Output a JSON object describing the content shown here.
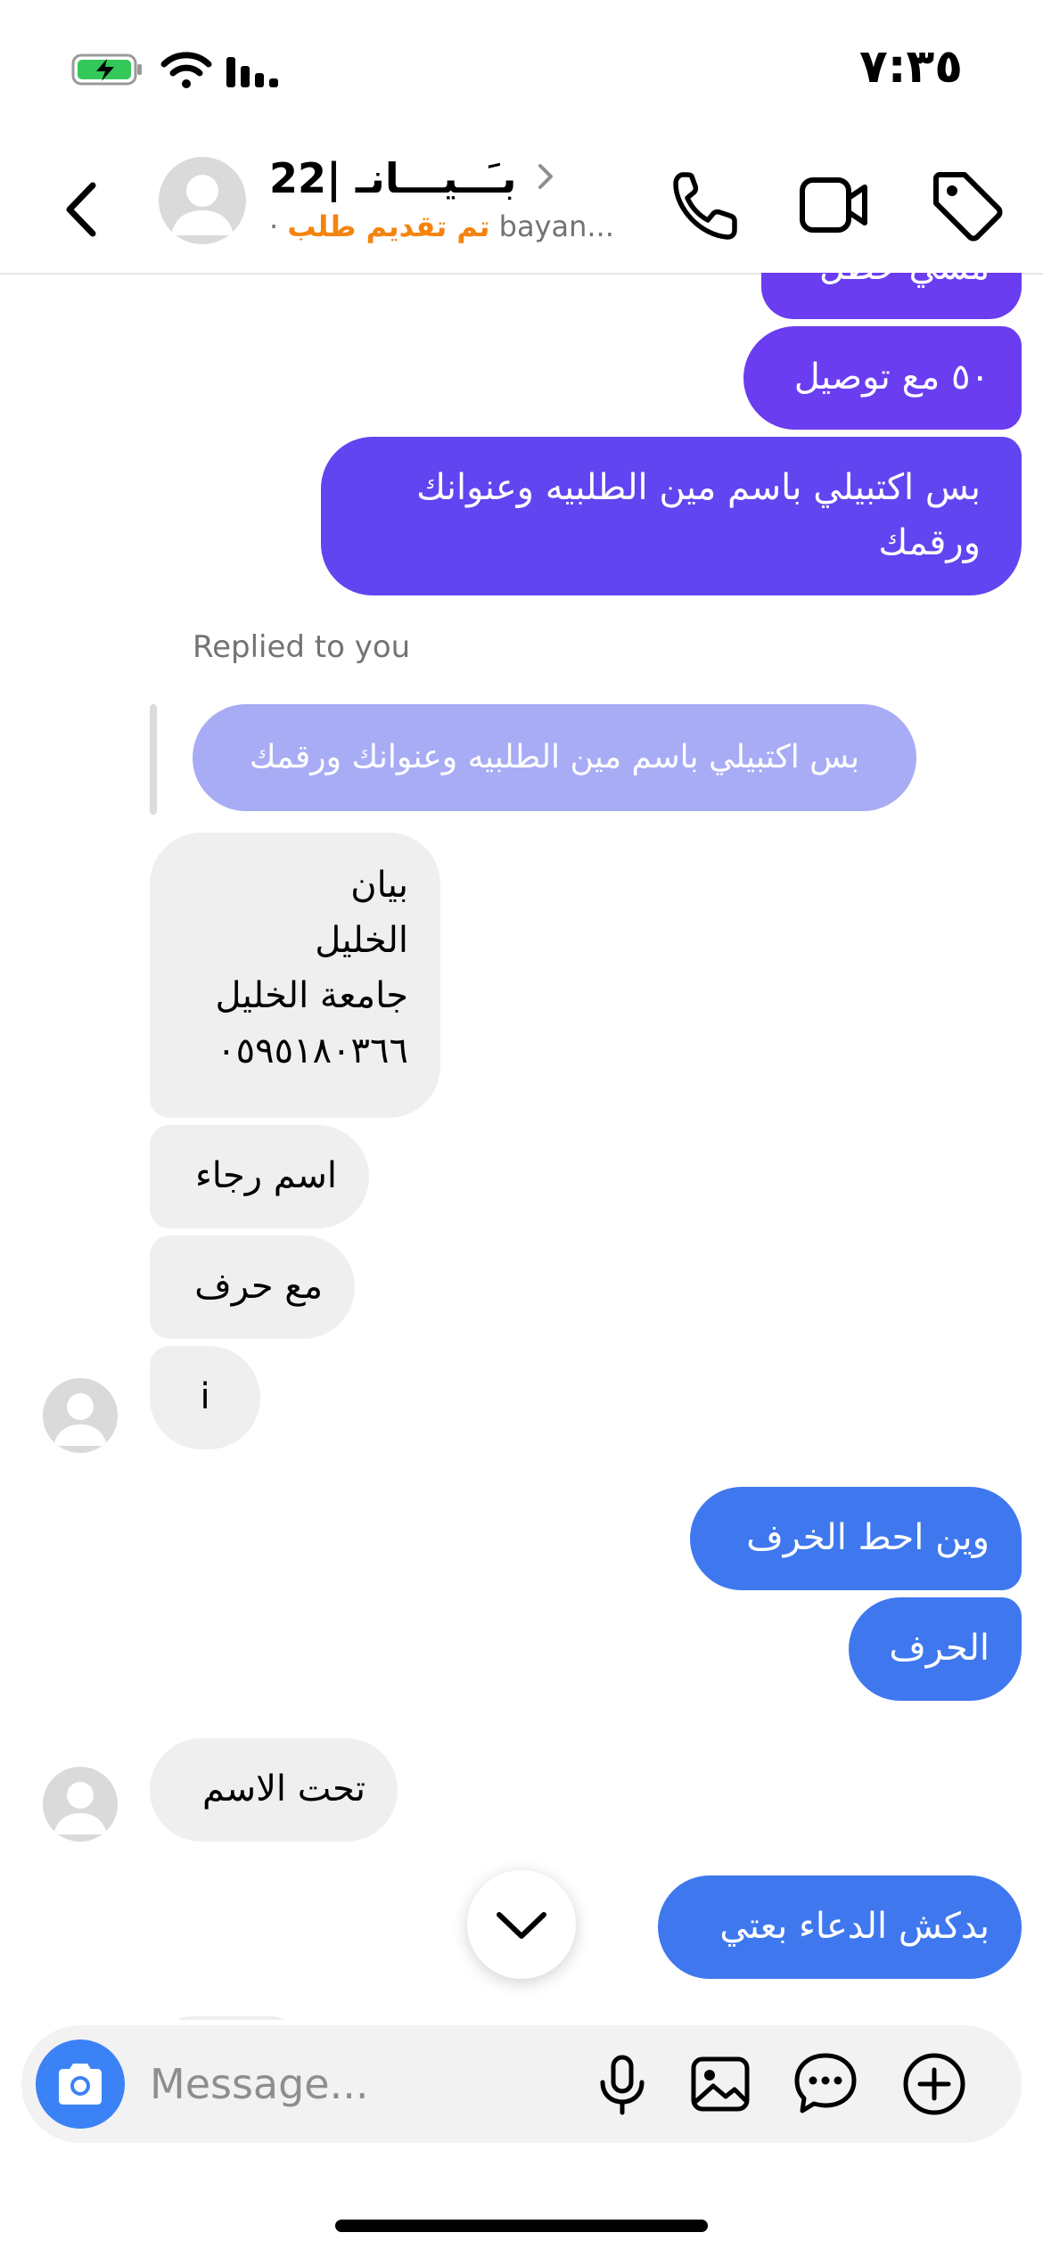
{
  "status_bar": {
    "time": "٧:٣٥"
  },
  "header": {
    "contact_name": "بـَــيـــانـ |22",
    "subtitle_username": "bayan...",
    "subtitle_status": "تم تقديم طلب",
    "subtitle_dot": "·"
  },
  "conversation": {
    "outgoing_top": [
      {
        "text": "مشي حطل"
      },
      {
        "text": "٥٠ مع توصيل"
      },
      {
        "text": "بس اكتبيلي باسم مين الطلبيه وعنوانك ورقمك"
      }
    ],
    "replied_label": "Replied to you",
    "reply_quote": "بس اكتبيلي باسم مين الطلبيه وعنوانك ورقمك",
    "incoming_first": [
      {
        "text": "بيان\nالخليل\nجامعة الخليل\n٠٥٩٥١٨٠٣٦٦"
      },
      {
        "text": "اسم رجاء"
      },
      {
        "text": "مع حرف"
      },
      {
        "text": "i"
      }
    ],
    "outgoing_middle": [
      {
        "text": "وين احط الخرف"
      },
      {
        "text": "الحرف"
      }
    ],
    "incoming_second": {
      "text": "تحت الاسم"
    },
    "outgoing_last": {
      "text": "بدكش الدعاء بعتي"
    }
  },
  "composer": {
    "placeholder": "Message..."
  },
  "colors": {
    "purple_dark": "#6a3df0",
    "purple_mid": "#6145f0",
    "blue_bubble": "#3f78ee",
    "incoming_bg": "#efefef",
    "order_status": "#f5830f"
  },
  "icons": [
    "battery-icon",
    "wifi-icon",
    "signal-icon",
    "back-icon",
    "phone-icon",
    "video-icon",
    "tag-icon",
    "chevron-down-icon",
    "camera-icon",
    "mic-icon",
    "gallery-icon",
    "sticker-icon",
    "plus-icon"
  ]
}
